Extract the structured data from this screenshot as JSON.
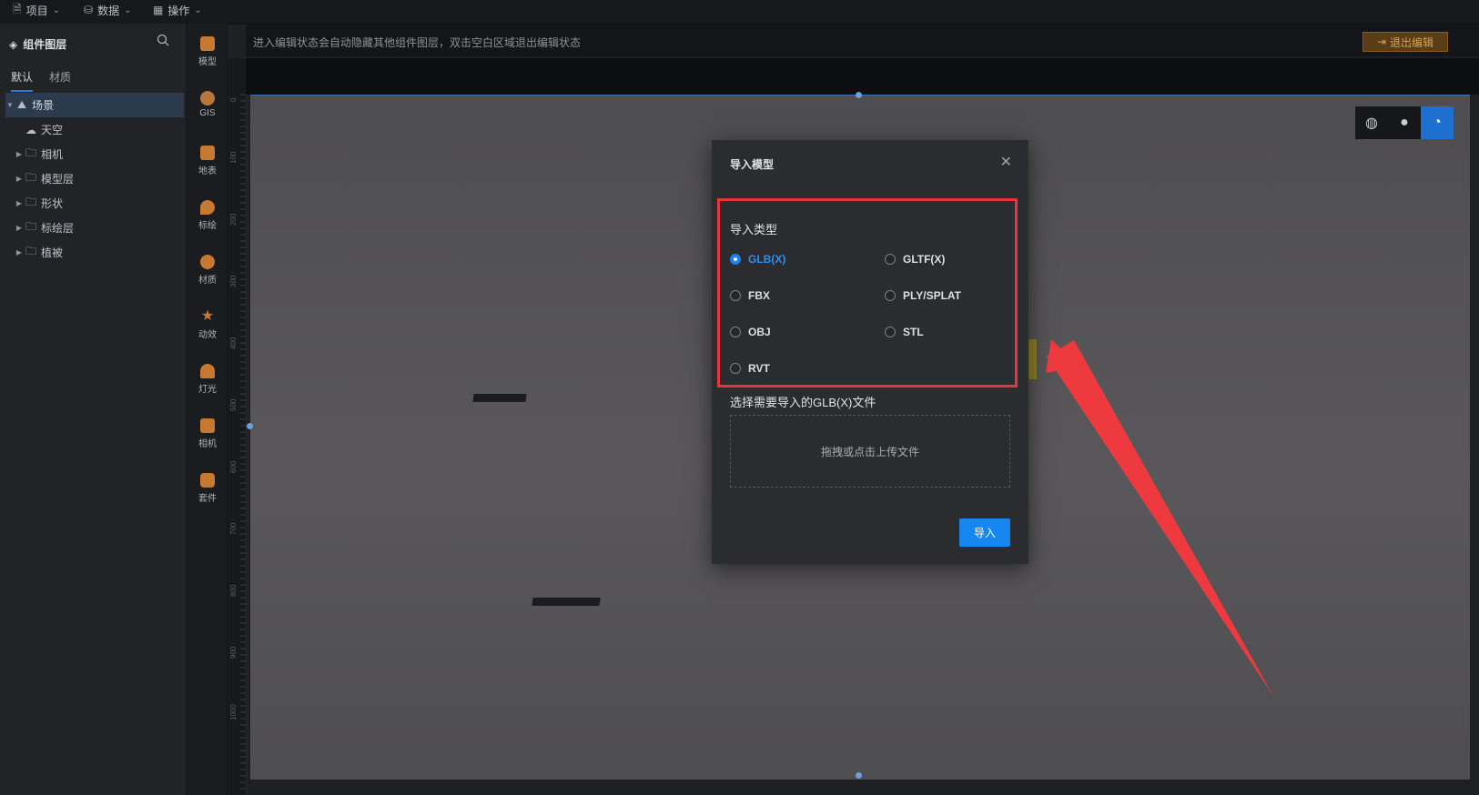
{
  "topbar": {
    "menus": [
      {
        "label": "项目",
        "icon": "file-icon"
      },
      {
        "label": "数据",
        "icon": "database-icon"
      },
      {
        "label": "操作",
        "icon": "grid-icon"
      }
    ]
  },
  "sidebar": {
    "title": "组件图层",
    "tabs": [
      "默认",
      "材质"
    ],
    "tree": [
      {
        "label": "场景",
        "icon": "scene-icon",
        "expanded": true,
        "selected": true,
        "level": 0
      },
      {
        "label": "天空",
        "icon": "sky-icon",
        "level": 1
      },
      {
        "label": "相机",
        "icon": "folder-icon",
        "level": 0
      },
      {
        "label": "模型层",
        "icon": "folder-icon",
        "level": 0
      },
      {
        "label": "形状",
        "icon": "folder-icon",
        "level": 0
      },
      {
        "label": "标绘层",
        "icon": "folder-icon",
        "level": 0
      },
      {
        "label": "植被",
        "icon": "folder-icon",
        "level": 0
      }
    ]
  },
  "iconbar": {
    "items": [
      {
        "label": "模型",
        "color": "#c7792f"
      },
      {
        "label": "GIS",
        "color": "#b9763a"
      },
      {
        "label": "地表",
        "color": "#c7792f"
      },
      {
        "label": "标绘",
        "color": "#c7792f"
      },
      {
        "label": "材质",
        "color": "#c7792f"
      },
      {
        "label": "动效",
        "color": "#c7792f"
      },
      {
        "label": "灯光",
        "color": "#c7792f"
      },
      {
        "label": "相机",
        "color": "#c7792f"
      },
      {
        "label": "套件",
        "color": "#c7792f"
      }
    ]
  },
  "editor": {
    "hint": "进入编辑状态会自动隐藏其他组件图层，双击空白区域退出编辑状态",
    "exit_label": "退出编辑",
    "ruler_v": [
      "0",
      "100",
      "200",
      "300",
      "400",
      "500",
      "600",
      "700",
      "800",
      "900",
      "1000"
    ]
  },
  "dialog": {
    "title": "导入模型",
    "section_label": "导入类型",
    "options": [
      {
        "label": "GLB(X)",
        "checked": true
      },
      {
        "label": "GLTF(X)",
        "checked": false
      },
      {
        "label": "FBX",
        "checked": false
      },
      {
        "label": "PLY/SPLAT",
        "checked": false
      },
      {
        "label": "OBJ",
        "checked": false
      },
      {
        "label": "STL",
        "checked": false
      },
      {
        "label": "RVT",
        "checked": false
      }
    ],
    "file_label": "选择需要导入的GLB(X)文件",
    "dropzone_text": "拖拽或点击上传文件",
    "import_label": "导入"
  },
  "colors": {
    "accent": "#1687f0",
    "highlight": "#e8343a"
  }
}
